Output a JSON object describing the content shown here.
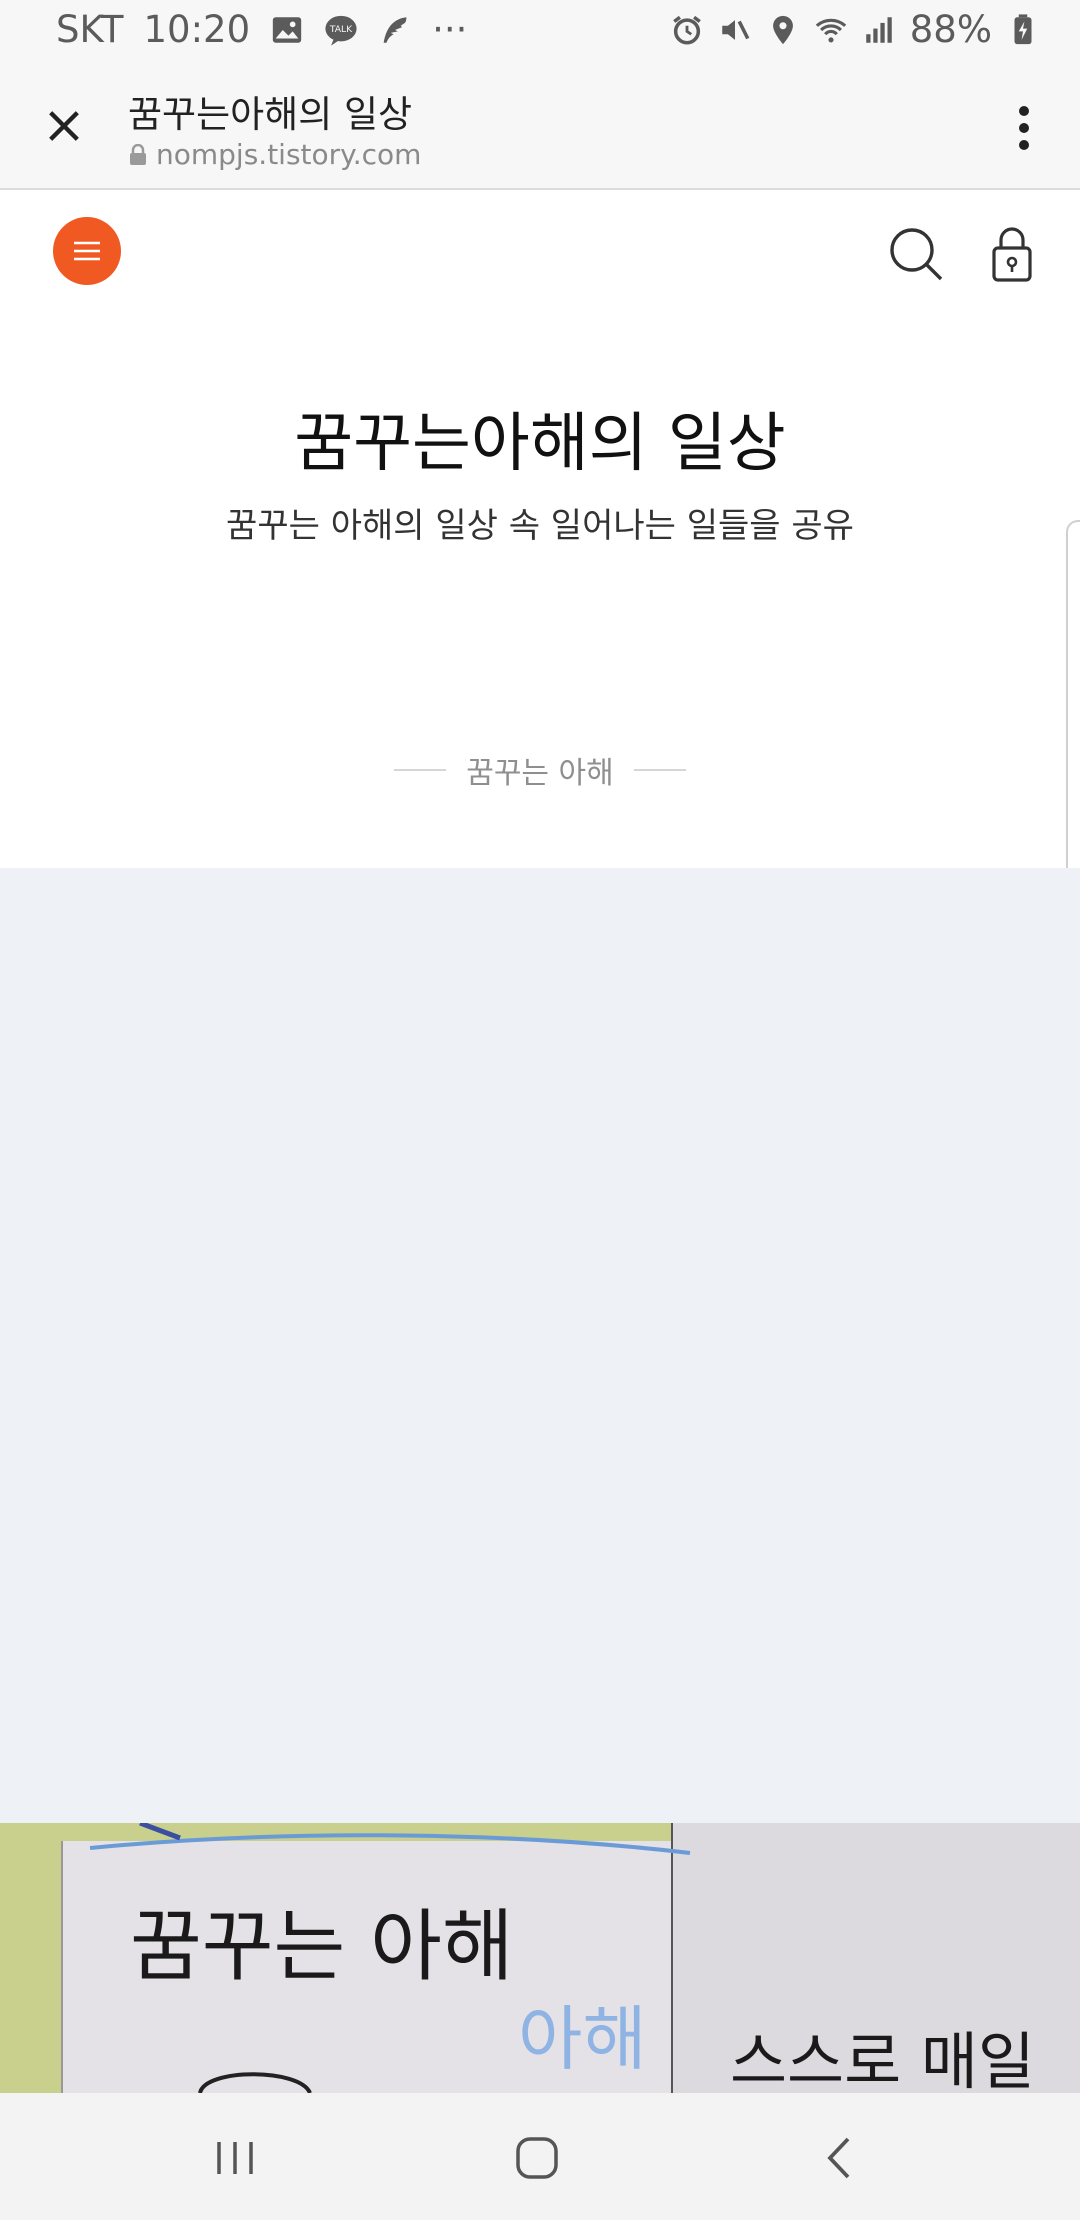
{
  "status_bar": {
    "carrier": "SKT",
    "time": "10:20",
    "more": "···",
    "battery": "88%",
    "talk_badge": "TALK"
  },
  "browser": {
    "page_title": "꿈꾸는아해의 일상",
    "url": "nompjs.tistory.com"
  },
  "blog": {
    "title": "꿈꾸는아해의 일상",
    "description": "꿈꾸는 아해의 일상 속 일어나는 일들을 공유",
    "author": "꿈꾸는 아해"
  },
  "photo": {
    "handwriting_main": "꿈꾸는 아해",
    "handwriting_blue": "아해",
    "handwriting_right": "스스로 매일"
  },
  "colors": {
    "accent": "#f05a22",
    "gray_area": "#eef2f7"
  }
}
